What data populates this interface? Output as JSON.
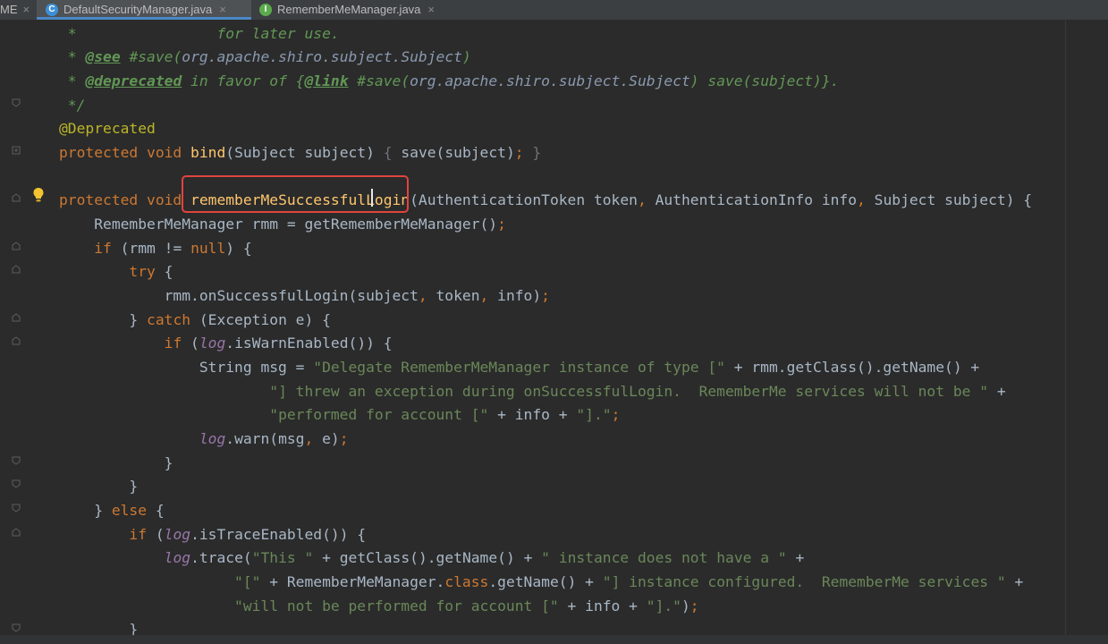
{
  "tabs": [
    {
      "label": "ME",
      "active": false,
      "icon": "none"
    },
    {
      "label": "DefaultSecurityManager.java",
      "active": true,
      "icon": "class-icon",
      "icon_letter": "C",
      "icon_color": "#3d8fd6"
    },
    {
      "label": "RememberMeManager.java",
      "active": false,
      "icon": "interface-icon",
      "icon_letter": "I",
      "icon_color": "#5bab4c"
    }
  ],
  "close_glyph": "×",
  "colors": {
    "background": "#2b2b2b",
    "keyword": "#cc7832",
    "method": "#ffc66d",
    "string": "#6a8759",
    "annotation": "#bbb529",
    "javadoc": "#629755",
    "field": "#9876aa",
    "highlight_box": "#e0443e"
  },
  "code": {
    "l1": {
      "a": " *",
      "b": "                for later use."
    },
    "l2": {
      "a": " * ",
      "tag": "@see",
      "b": " #save(",
      "ref": "org.apache.shiro.subject.Subject",
      "c": ")"
    },
    "l3": {
      "a": " * ",
      "tag": "@deprecated",
      "b": " in favor of {",
      "tag2": "@link",
      "c": " #save(",
      "ref": "org.apache.shiro.subject.Subject",
      "d": ") save(subject)}."
    },
    "l4": {
      "a": " */"
    },
    "l5": {
      "ann": "@Deprecated"
    },
    "l6": {
      "kw": "protected void ",
      "fn": "bind",
      "a": "(Subject subject) ",
      "f1": "{",
      "b": " save(subject)",
      "semi": ";",
      "sp": " ",
      "f2": "}"
    },
    "l8": {
      "kw": "protected void ",
      "fn": "rememberMeSuccessfulLogin",
      "a": "(AuthenticationToken token",
      "c1": ",",
      "b": " AuthenticationInfo info",
      "c2": ",",
      "c": " Subject subject) {"
    },
    "l9": {
      "a": "    RememberMeManager rmm = getRememberMeManager()",
      "semi": ";"
    },
    "l10": {
      "ind": "    ",
      "kw": "if",
      "a": " (rmm != ",
      "kw2": "null",
      "b": ") {"
    },
    "l11": {
      "ind": "        ",
      "kw": "try",
      "a": " {"
    },
    "l12": {
      "a": "            rmm.onSuccessfulLogin(subject",
      "c1": ",",
      "b": " token",
      "c2": ",",
      "c": " info)",
      "semi": ";"
    },
    "l13": {
      "a": "        } ",
      "kw": "catch",
      "b": " (Exception e) {"
    },
    "l14": {
      "ind": "            ",
      "kw": "if",
      "a": " (",
      "f": "log",
      "b": ".isWarnEnabled()) {"
    },
    "l15": {
      "a": "                String msg = ",
      "s": "\"Delegate RememberMeManager instance of type [\"",
      "b": " + rmm.getClass().getName() +"
    },
    "l16": {
      "ind": "                        ",
      "s": "\"] threw an exception during onSuccessfulLogin.  RememberMe services will not be \"",
      "b": " +"
    },
    "l17": {
      "ind": "                        ",
      "s": "\"performed for account [\"",
      "a": " + info + ",
      "s2": "\"].\"",
      "semi": ";"
    },
    "l18": {
      "ind": "                ",
      "f": "log",
      "a": ".warn(msg",
      "c1": ",",
      "b": " e)",
      "semi": ";"
    },
    "l19": {
      "a": "            }"
    },
    "l20": {
      "a": "        }"
    },
    "l21": {
      "a": "    } ",
      "kw": "else",
      "b": " {"
    },
    "l22": {
      "ind": "        ",
      "kw": "if",
      "a": " (",
      "f": "log",
      "b": ".isTraceEnabled()) {"
    },
    "l23": {
      "ind": "            ",
      "f": "log",
      "a": ".trace(",
      "s": "\"This \"",
      "b": " + getClass().getName() + ",
      "s2": "\" instance does not have a \"",
      "c": " +"
    },
    "l24": {
      "ind": "                    ",
      "s": "\"[\"",
      "a": " + RememberMeManager.",
      "kw": "class",
      "b": ".getName() + ",
      "s2": "\"] instance configured.  RememberMe services \"",
      "c": " +"
    },
    "l25": {
      "ind": "                    ",
      "s": "\"will not be performed for account [\"",
      "a": " + info + ",
      "s2": "\"].\"",
      "b": ")",
      "semi": ";"
    },
    "l26": {
      "a": "        }"
    }
  }
}
